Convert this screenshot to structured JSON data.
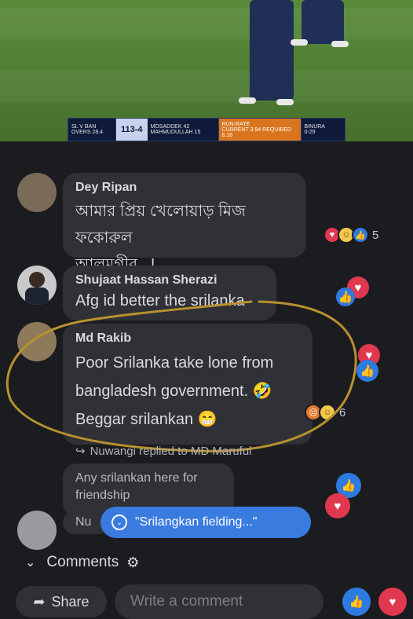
{
  "scoreboard": {
    "teams": "SL V BAN",
    "overs": "OVERS 28.4",
    "score": "113-4",
    "batsman1": "MOSADDEK",
    "batsman1_score": "42",
    "batsman2": "MAHMUDULLAH",
    "batsman2_score": "15",
    "runrate_label": "RUN-RATE",
    "current": "CURRENT 3.94",
    "required": "REQUIRED 8.16",
    "bowler": "BINURA",
    "bowler_figures": "0-29"
  },
  "comments": [
    {
      "name": "Dey Ripan",
      "text_line1": "আমার প্রিয় খেলোয়াড় মিজ ফকোরুল",
      "text_line2": "আলমগীর...!",
      "reactions_count": "5"
    },
    {
      "name": "Shujaat Hassan Sherazi",
      "text": "Afg id better the srilanka"
    },
    {
      "name": "Md Rakib",
      "text_line1": "Poor Srilanka take lone from",
      "text_line2": "bangladesh government. 🤣",
      "text_line3": "Beggar srilankan 😁",
      "reactions_count": "6"
    },
    {
      "name": "Nuwangi",
      "text_line1": "Any srilankan here for",
      "text_line2": "friendship"
    }
  ],
  "reply_line": "Nuwangi replied to MD Maruful",
  "partial_name": "Nu",
  "new_comments_pill": "\"Srilangkan fielding...\"",
  "comments_label": "Comments",
  "share_label": "Share",
  "write_placeholder": "Write a comment",
  "colors": {
    "annotation_circle": "#b8912e",
    "pill": "#3a7be0",
    "background": "#1b1c20"
  }
}
